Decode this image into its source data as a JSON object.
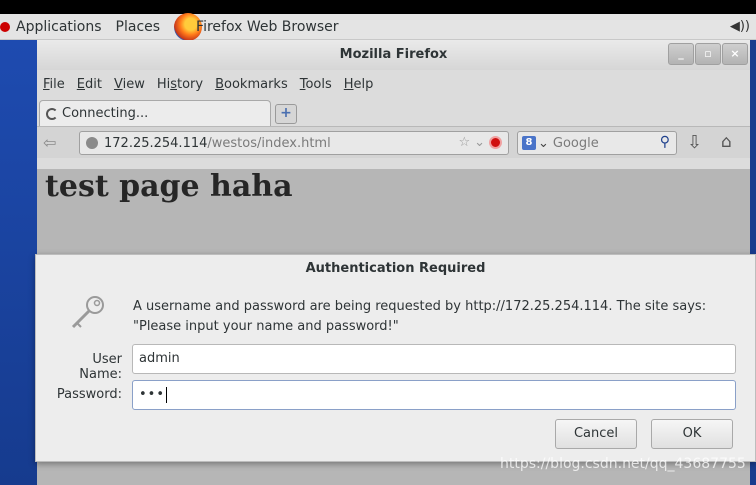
{
  "topbar": {
    "applications_label": "Applications",
    "places_label": "Places",
    "active_app_label": "Firefox Web Browser"
  },
  "window": {
    "title": "Mozilla Firefox",
    "controls": [
      "_",
      "▫",
      "×"
    ]
  },
  "menubar": {
    "items": [
      {
        "label": "File",
        "accel": "F"
      },
      {
        "label": "Edit",
        "accel": "E"
      },
      {
        "label": "View",
        "accel": "V"
      },
      {
        "label": "History",
        "accel": "s"
      },
      {
        "label": "Bookmarks",
        "accel": "B"
      },
      {
        "label": "Tools",
        "accel": "T"
      },
      {
        "label": "Help",
        "accel": "H"
      }
    ]
  },
  "tabs": [
    {
      "label": "Connecting..."
    }
  ],
  "navbar": {
    "url_host": "172.25.254.114",
    "url_path": "/westos/index.html",
    "search_placeholder": "Google"
  },
  "page": {
    "heading": "test page haha"
  },
  "auth_dialog": {
    "title": "Authentication Required",
    "message": "A username and password are being requested by http://172.25.254.114. The site says: \"Please input your name and password!\"",
    "username_label": "User Name:",
    "username_value": "admin",
    "password_label": "Password:",
    "password_mask": "•••",
    "cancel_label": "Cancel",
    "ok_label": "OK"
  },
  "watermark": "https://blog.csdn.net/qq_43687755"
}
